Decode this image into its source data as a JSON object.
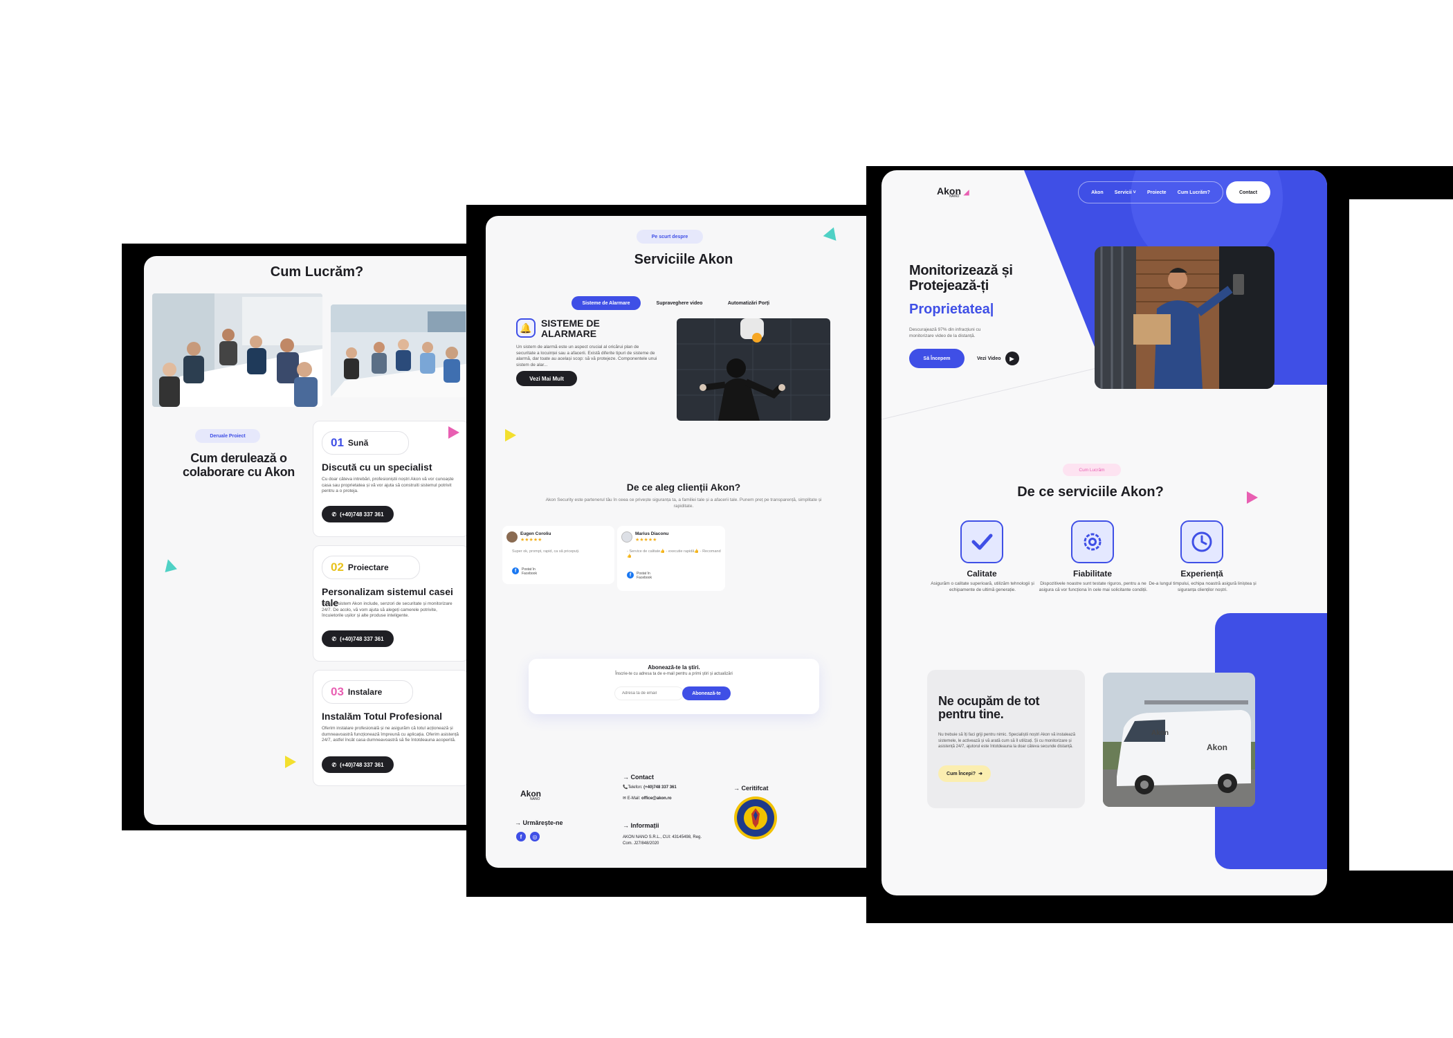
{
  "colors": {
    "accent": "#3f4fe6",
    "dark": "#1f1f24",
    "pink": "#e85fb2",
    "teal": "#4fd1c5",
    "yellow": "#f3df2e"
  },
  "left": {
    "title": "Cum Lucrăm?",
    "badge": "Deruale Proiect",
    "heading": "Cum derulează o colaborare cu Akon",
    "steps": [
      {
        "num": "01",
        "tag": "Sună",
        "title": "Discută cu un specialist",
        "desc": "Cu doar câteva intrebări, profesioniștii noștri Akon vă vor cunoaște casa sau proprietatea și vă vor ajuta să construiti sistemul potrivit pentru a o proteja.",
        "phone": "(+40)748 337 361"
      },
      {
        "num": "02",
        "tag": "Proiectare",
        "title": "Personalizam sistemul casei tale",
        "desc": "Fiecare sistem Akon include, senzori de securitate și monitorizare 24/7. De acolo, vă vom ajuta să alegeți camerele potrivite, încuietorile ușilor și alte produse inteligente.",
        "phone": "(+40)748 337 361"
      },
      {
        "num": "03",
        "tag": "Instalare",
        "title": "Instalăm Totul Profesional",
        "desc": "Oferim instalare profesională și ne asigurăm că totul acționează și dumneavoastră funcționează împreună cu aplicația. Oferim asistență 24/7, astfel încât casa dumneavoastră să fie întotdeauna acoperită.",
        "phone": "(+40)748 337 361"
      }
    ]
  },
  "middle": {
    "badge": "Pe scurt despre",
    "title": "Serviciile Akon",
    "tabs": [
      "Sisteme de Alarmare",
      "Supraveghere video",
      "Automatizări Porți"
    ],
    "service_title": "SISTEME DE ALARMARE",
    "service_desc": "Un sistem de alarmă este un aspect crucial al oricărui plan de securitate a locuinței sau a afacerii. Există diferite tipuri de sisteme de alarmă, dar toate au același scop: să vă protejeze. Componentele unui sistem de alar...",
    "service_button": "Vezi Mai Mult",
    "why_title": "De ce aleg clienții Akon?",
    "why_desc": "Akon Security este partenerul tău în ceea ce privește siguranța ta, a familiei tale și a afacerii tale. Punem preț pe transparență, simplitate și rapiditate.",
    "reviews": [
      {
        "name": "Eugen Coroliu",
        "stars": "★★★★★",
        "text": "Super ok, prompt, rapid, ca să pricepuți.",
        "source": "Postat în Facebook"
      },
      {
        "name": "Marius Diaconu",
        "stars": "★★★★★",
        "text": "- Service de calitate👍 - executie rapidă👍 - Recomand👍",
        "source": "Postat în Facebook"
      }
    ],
    "newsletter_title": "Abonează-te la știri.",
    "newsletter_desc": "Înscrie-te cu adresa ta de e-mail pentru a primi știri și actualizări",
    "newsletter_placeholder": "Adresa ta de email",
    "newsletter_button": "Abonează-te",
    "footer": {
      "logo": "Akon",
      "logo_sub": "NANO",
      "follow": "Urmărește-ne",
      "contact_title": "Contact",
      "phone_label": "Telefon:",
      "phone": "(+40)748 337 361",
      "email_label": "E-Mail:",
      "email": "office@akon.ro",
      "info_title": "Informații",
      "info_text": "AKON NANO S.R.L., CUI: 43145498, Reg. Com. J27/848/2020",
      "cert_title": "Ceritifcat"
    }
  },
  "right": {
    "logo": "Akon",
    "logo_sub": "NANO",
    "nav": [
      "Akon",
      "Servicii ˅",
      "Proiecte",
      "Cum Lucrăm?"
    ],
    "contact_button": "Contact",
    "hero_title": "Monitorizează și Protejează-ți",
    "hero_highlight": "Proprietatea|",
    "hero_desc": "Descurajează 97% din infracțiuni cu monitorizare video de la distanță.",
    "cta_primary": "Să Începem",
    "cta_secondary": "Vezi Video",
    "section_badge": "Cum Lucrăm",
    "section_title": "De ce serviciile Akon?",
    "features": [
      {
        "icon": "check-icon",
        "label": "Calitate",
        "desc": "Asigurăm o calitate superioară, utilizăm tehnologii și echipamente de ultimă generație."
      },
      {
        "icon": "gear-icon",
        "label": "Fiabilitate",
        "desc": "Dispozitivele noastre sunt testate riguros, pentru a ne asigura că vor funcționa în cele mai solicitante condiții."
      },
      {
        "icon": "clock-icon",
        "label": "Experiență",
        "desc": "De-a lungul timpului, echipa noastră asigură liniștea și siguranța clienților noștri."
      }
    ],
    "care_title": "Ne ocupăm de tot pentru tine.",
    "care_desc": "Nu trebuie să îți faci griji pentru nimic. Specialiștii noștri Akon vă instalează sistemele, le activează și vă arată cum să îl utilizați. Și cu monitorizare și asistență 24/7, ajutorul este întotdeauna la doar câteva secunde distanță.",
    "care_button": "Cum Începi?"
  }
}
